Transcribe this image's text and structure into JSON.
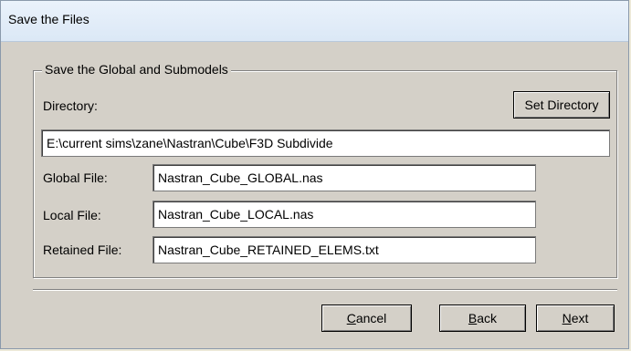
{
  "window": {
    "title": "Save the Files"
  },
  "group": {
    "legend": "Save the Global and Submodels"
  },
  "directory": {
    "label": "Directory:",
    "set_button": "Set Directory",
    "value": "E:\\current sims\\zane\\Nastran\\Cube\\F3D Subdivide"
  },
  "files": {
    "global_label": "Global File:",
    "global_value": "Nastran_Cube_GLOBAL.nas",
    "local_label": "Local File:",
    "local_value": "Nastran_Cube_LOCAL.nas",
    "retained_label": "Retained File:",
    "retained_value": "Nastran_Cube_RETAINED_ELEMS.txt"
  },
  "buttons": {
    "cancel_mnemonic": "C",
    "cancel_rest": "ancel",
    "back_mnemonic": "B",
    "back_rest": "ack",
    "next_mnemonic": "N",
    "next_rest": "ext"
  }
}
